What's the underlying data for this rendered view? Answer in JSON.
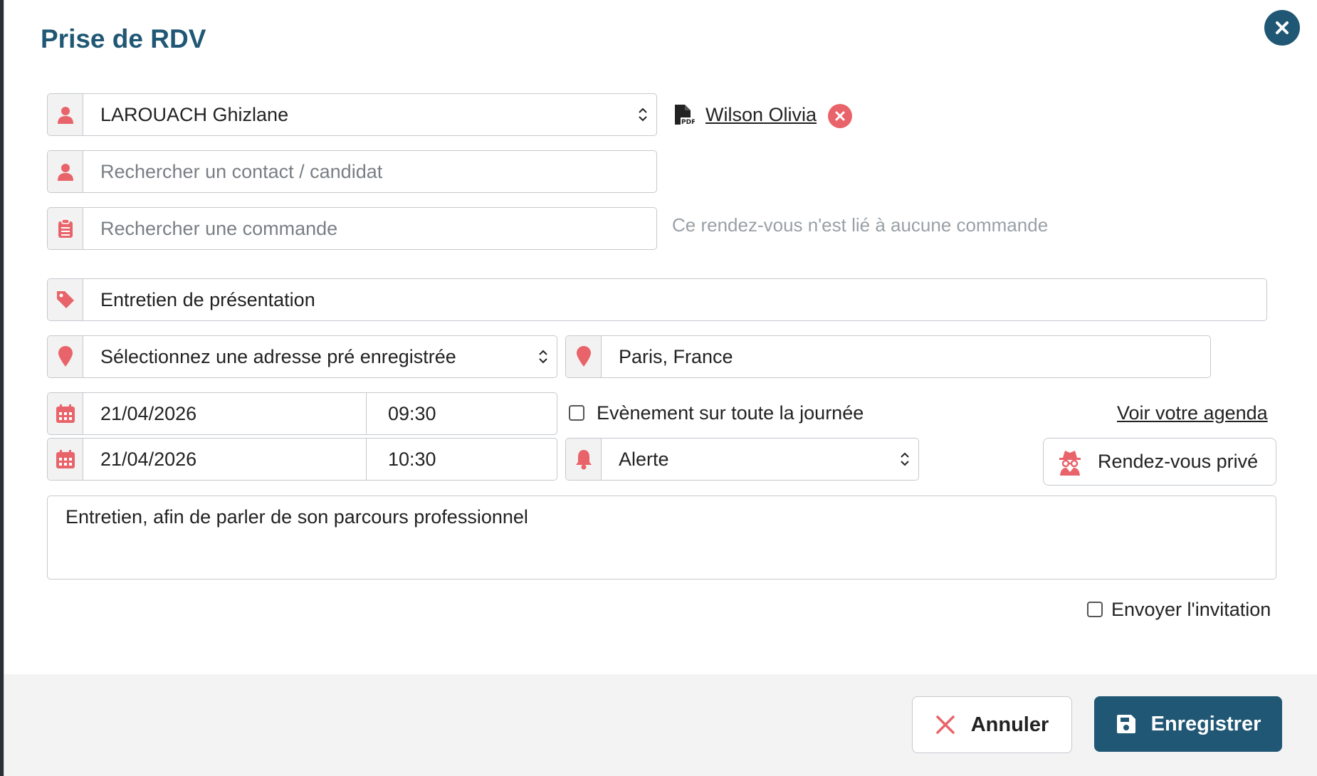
{
  "dialog": {
    "title": "Prise de RDV"
  },
  "form": {
    "consultant_select": "LAROUACH Ghizlane",
    "linked_contact": "Wilson Olivia",
    "contact_search_placeholder": "Rechercher un contact / candidat",
    "order_search_placeholder": "Rechercher une commande",
    "order_hint": "Ce rendez-vous n'est lié à aucune commande",
    "subject": "Entretien de présentation",
    "address_select": "Sélectionnez une adresse pré enregistrée",
    "location": "Paris, France",
    "start_date": "21/04/2026",
    "start_time": "09:30",
    "end_date": "21/04/2026",
    "end_time": "10:30",
    "all_day_label": "Evènement sur toute la journée",
    "agenda_link": "Voir votre agenda",
    "alert_select": "Alerte",
    "private_button": "Rendez-vous privé",
    "notes": "Entretien, afin de parler de son parcours professionnel",
    "send_invitation_label": "Envoyer l'invitation"
  },
  "footer": {
    "cancel_label": "Annuler",
    "save_label": "Enregistrer"
  },
  "colors": {
    "primary": "#1f5774",
    "icon_accent": "#e8646a"
  }
}
